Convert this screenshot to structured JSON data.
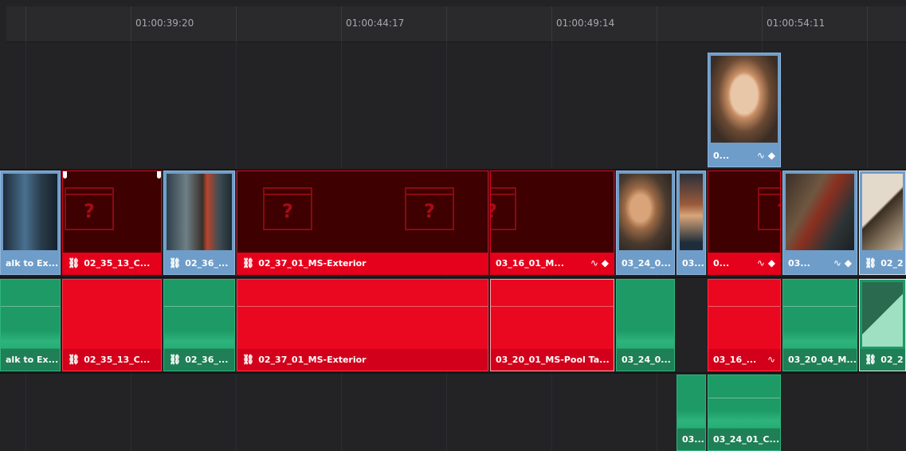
{
  "ruler": {
    "timecodes": [
      "01:00:39:20",
      "01:00:44:17",
      "01:00:49:14",
      "01:00:54:11"
    ]
  },
  "tracks": {
    "video2": {
      "clip_label": "0..."
    },
    "video1": {
      "clips": [
        "alk to Ex...",
        "02_35_13_C...",
        "02_36_...",
        "02_37_01_MS-Exterior",
        "03_16_01_M...",
        "03_24_0...",
        "03...",
        "0...",
        "03...",
        "02_2"
      ]
    },
    "audio1": {
      "clips": [
        "alk to Ex...",
        "02_35_13_C...",
        "02_36_...",
        "02_37_01_MS-Exterior",
        "03_20_01_MS-Pool Ta...",
        "03_24_0...",
        "03_16_...",
        "03_20_04_M...",
        "02_2"
      ]
    },
    "audio2": {
      "clips": [
        "03...",
        "03_24_01_C..."
      ]
    }
  },
  "icons": {
    "link": "link-icon",
    "curve": "curve-icon",
    "keyframe": "keyframe-icon",
    "missing_media": "missing-media-icon"
  },
  "colors": {
    "video_clip": "#6f9dc9",
    "missing_clip": "#e5001c",
    "audio_clip": "#1f7f56"
  }
}
